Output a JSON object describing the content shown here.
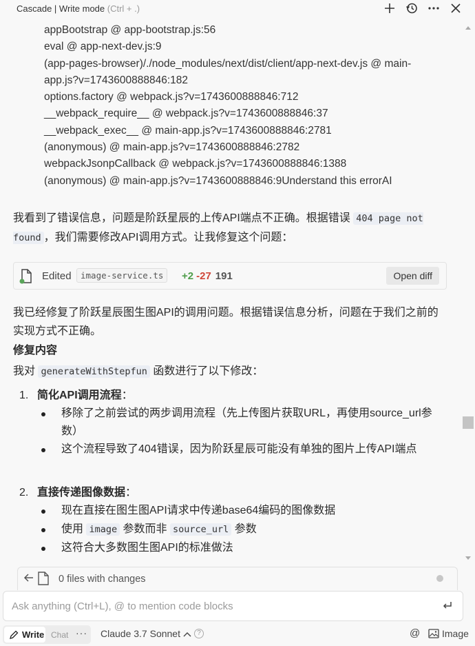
{
  "window": {
    "title": "Cascade | Write mode",
    "title_hint": "(Ctrl + .)"
  },
  "trace_lines": [
    "appBootstrap @ app-bootstrap.js:56",
    "eval @ app-next-dev.js:9",
    "(app-pages-browser)/./node_modules/next/dist/client/app-next-dev.js @ main-",
    "app.js?v=1743600888846:182",
    "options.factory @ webpack.js?v=1743600888846:712",
    "__webpack_require__ @ webpack.js?v=1743600888846:37",
    "__webpack_exec__ @ main-app.js?v=1743600888846:2781",
    "(anonymous) @ main-app.js?v=1743600888846:2782",
    "webpackJsonpCallback @ webpack.js?v=1743600888846:1388",
    "(anonymous) @ main-app.js?v=1743600888846:9Understand this errorAI"
  ],
  "para1": {
    "pre": "我看到了错误信息，问题是阶跃星辰的上传API端点不正确。根据错误 ",
    "code": "404 page not found",
    "post": "，我们需要修改API调用方式。让我修复这个问题："
  },
  "edited": {
    "label": "Edited",
    "file": "image-service.ts",
    "added": "+2",
    "removed": "-27",
    "total": "191",
    "button": "Open diff"
  },
  "para2": "我已经修复了阶跃星辰图生图API的调用问题。根据错误信息分析，问题在于我们之前的实现方式不正确。",
  "section_heading": "修复内容",
  "para3": {
    "pre": "我对 ",
    "code": "generateWithStepfun",
    "post": " 函数进行了以下修改："
  },
  "list": [
    {
      "num": "1.",
      "title": "简化API调用流程",
      "colon": "：",
      "bullets": [
        "移除了之前尝试的两步调用流程（先上传图片获取URL，再使用source_url参数）",
        "这个流程导致了404错误，因为阶跃星辰可能没有单独的图片上传API端点"
      ]
    },
    {
      "num": "2.",
      "title": "直接传递图像数据",
      "colon": "：",
      "bullets": [
        "现在直接在图生图API请求中传递base64编码的图像数据",
        "这符合大多数图生图API的标准做法"
      ],
      "code_bullet": {
        "pre": "使用 ",
        "code1": "image",
        "mid": " 参数而非 ",
        "code2": "source_url",
        "post": " 参数"
      }
    }
  ],
  "changes_bar": {
    "label": "0 files with changes"
  },
  "input": {
    "placeholder": "Ask anything (Ctrl+L), @ to mention code blocks"
  },
  "bottom": {
    "write": "Write",
    "chat": "Chat",
    "more": "···",
    "model": "Claude 3.7 Sonnet",
    "help": "?",
    "at": "@",
    "image": "Image"
  }
}
